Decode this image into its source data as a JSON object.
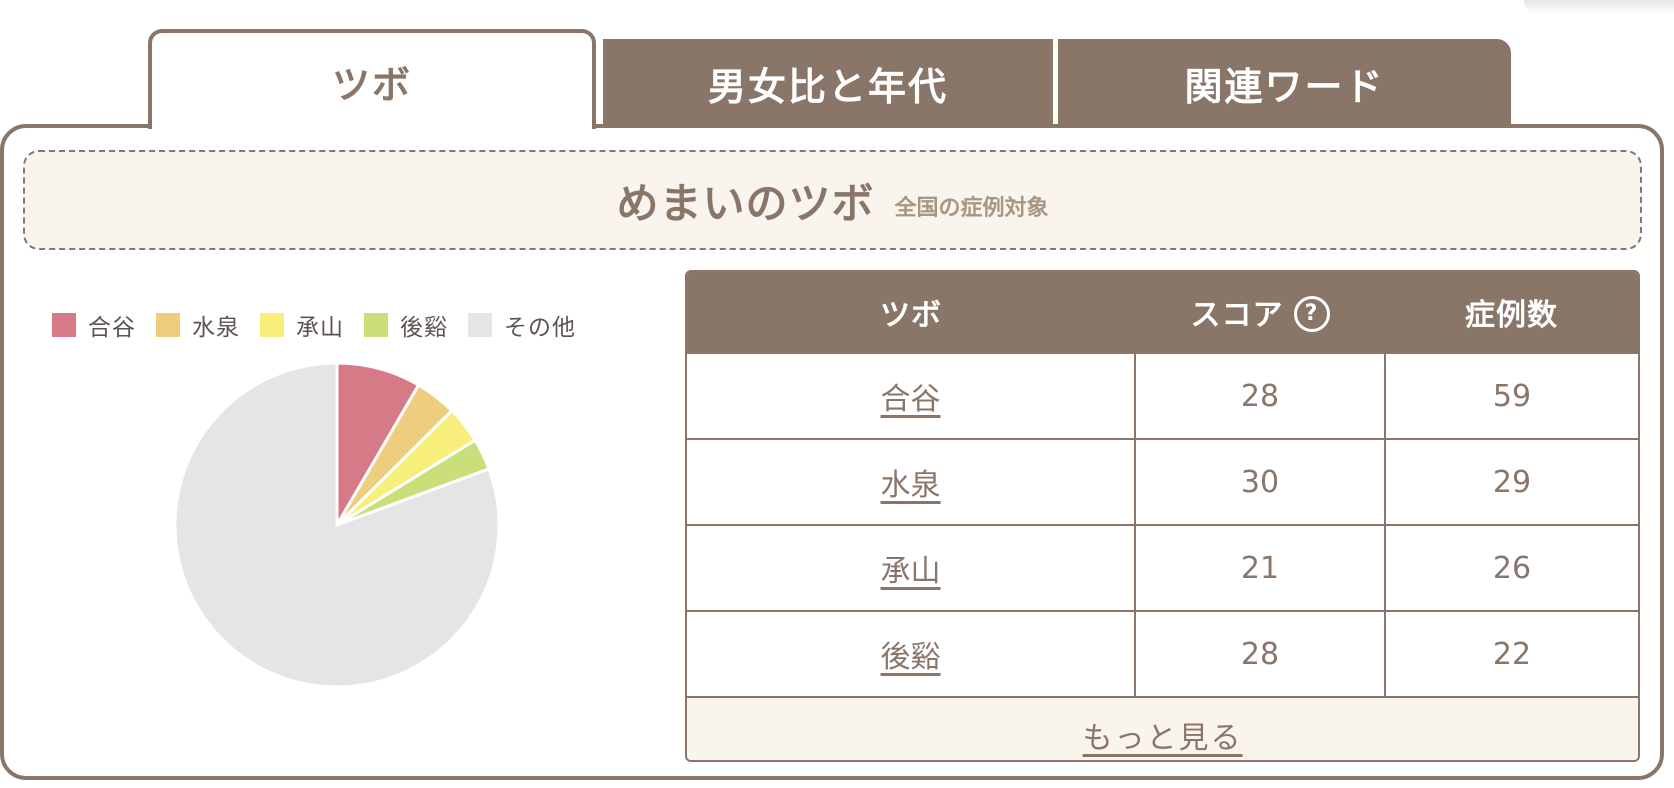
{
  "tabs": [
    {
      "label": "ツボ",
      "active": true
    },
    {
      "label": "男女比と年代",
      "active": false
    },
    {
      "label": "関連ワード",
      "active": false
    }
  ],
  "heading": {
    "title": "めまいのツボ",
    "subtitle": "全国の症例対象"
  },
  "colors": {
    "brand": "#8a7668",
    "panel_bg": "#f9f5ee",
    "slice_1": "#d67a88",
    "slice_2": "#eecd7e",
    "slice_3": "#f8ee7c",
    "slice_4": "#c9e07a",
    "slice_other": "#e5e5e5"
  },
  "chart_data": {
    "type": "pie",
    "categories": [
      "合谷",
      "水泉",
      "承山",
      "後谿",
      "その他"
    ],
    "values": [
      59,
      29,
      26,
      22,
      566
    ],
    "legend_position": "top"
  },
  "table": {
    "headers": {
      "tsubo": "ツボ",
      "score": "スコア",
      "cases": "症例数"
    },
    "help_icon": "question-circle-icon",
    "rows": [
      {
        "tsubo": "合谷",
        "score": "28",
        "cases": "59"
      },
      {
        "tsubo": "水泉",
        "score": "30",
        "cases": "29"
      },
      {
        "tsubo": "承山",
        "score": "21",
        "cases": "26"
      },
      {
        "tsubo": "後谿",
        "score": "28",
        "cases": "22"
      }
    ],
    "more_label": "もっと見る"
  }
}
